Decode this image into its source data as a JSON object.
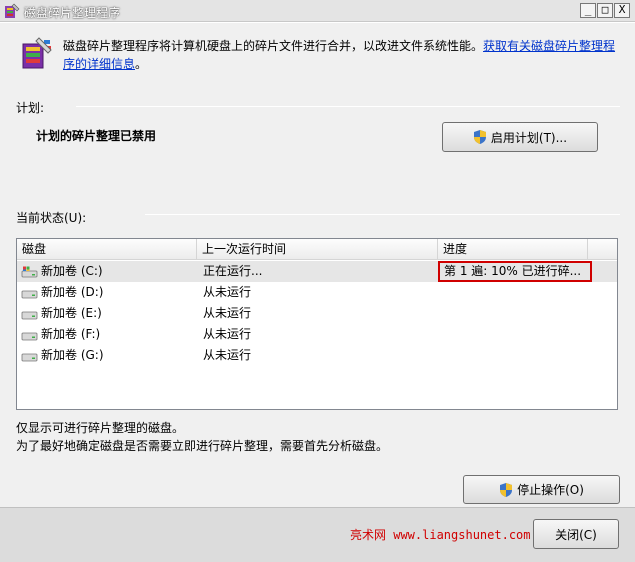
{
  "window": {
    "title": "磁盘碎片整理程序",
    "minimize_glyph": "_",
    "maximize_glyph": "□",
    "close_glyph": "X"
  },
  "intro": {
    "text": "磁盘碎片整理程序将计算机硬盘上的碎片文件进行合并，以改进文件系统性能。",
    "link_text": "获取有关磁盘碎片整理程序的详细信息",
    "suffix": "。"
  },
  "schedule": {
    "label": "计划:",
    "status": "计划的碎片整理已禁用",
    "enable_button_label": "启用计划(T)..."
  },
  "current_status": {
    "label": "当前状态(U):",
    "columns": [
      "磁盘",
      "上一次运行时间",
      "进度"
    ],
    "rows": [
      {
        "disk": "新加卷 (C:)",
        "last_run": "正在运行...",
        "progress": "第 1 遍: 10% 已进行碎..."
      },
      {
        "disk": "新加卷 (D:)",
        "last_run": "从未运行",
        "progress": ""
      },
      {
        "disk": "新加卷 (E:)",
        "last_run": "从未运行",
        "progress": ""
      },
      {
        "disk": "新加卷 (F:)",
        "last_run": "从未运行",
        "progress": ""
      },
      {
        "disk": "新加卷 (G:)",
        "last_run": "从未运行",
        "progress": ""
      }
    ]
  },
  "notes": {
    "line1": "仅显示可进行碎片整理的磁盘。",
    "line2": "为了最好地确定磁盘是否需要立即进行碎片整理，需要首先分析磁盘。"
  },
  "buttons": {
    "stop_label": "停止操作(O)",
    "close_label": "关闭(C)"
  },
  "watermark": "亮术网 www.liangshunet.com",
  "colors": {
    "highlight_border": "#d00000",
    "link": "#0033cc",
    "watermark": "#d00000"
  }
}
